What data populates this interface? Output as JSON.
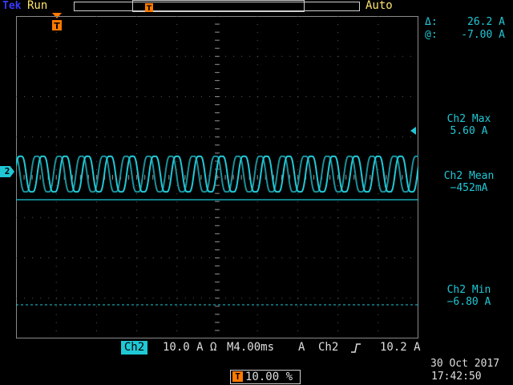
{
  "header": {
    "brand": "Tek",
    "run_state": "Run",
    "trigger_mode": "Auto"
  },
  "cursor": {
    "delta_label": "Δ:",
    "delta_value": "26.2 A",
    "at_label": "@:",
    "at_value": "-7.00 A"
  },
  "measurements": [
    {
      "label": "Ch2 Max",
      "value": "5.60 A"
    },
    {
      "label": "Ch2 Mean",
      "value": "−452mA"
    },
    {
      "label": "Ch2 Min",
      "value": "−6.80 A"
    }
  ],
  "channel": {
    "marker": "2",
    "name": "Ch2",
    "scale": "10.0 A Ω",
    "color": "#20c8d6"
  },
  "timebase": {
    "setting": "M4.00ms",
    "trigger_coupling": "A",
    "trigger_source": "Ch2",
    "trigger_slope_icon": "rising-edge-icon",
    "trigger_level": "10.2 A"
  },
  "trigger_position": {
    "badge": "T",
    "value": "10.00 %"
  },
  "datetime": {
    "date": "30 Oct  2017",
    "time": "17:42:50"
  },
  "colors": {
    "trace": "#20c8d6",
    "trace_dim": "#1a8f99",
    "status": "#ffe36a",
    "trigger": "#ff7a00",
    "grid": "#8a8a8a"
  },
  "chart_data": {
    "type": "line",
    "series": [
      {
        "amplitude_divisions": 0.5,
        "cycles": 18
      },
      {
        "amplitude_divisions": 0.5,
        "cycles": 18
      }
    ],
    "grid": true
  }
}
